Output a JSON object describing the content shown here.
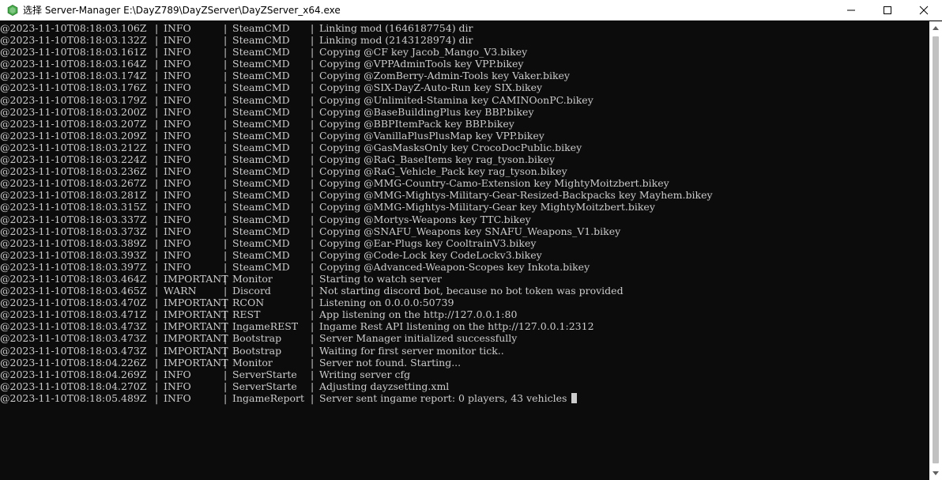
{
  "window": {
    "title": "选择 Server-Manager E:\\DayZ789\\DayZServer\\DayZServer_x64.exe",
    "app_icon": "green-hexagon-icon",
    "controls": {
      "minimize": "minimize-icon",
      "maximize": "maximize-icon",
      "close": "close-icon"
    }
  },
  "console": {
    "separator": "|",
    "lines": [
      {
        "ts": "@2023-11-10T08:18:03.106Z",
        "level": "INFO",
        "source": "SteamCMD",
        "message": "Linking mod (1646187754) dir"
      },
      {
        "ts": "@2023-11-10T08:18:03.132Z",
        "level": "INFO",
        "source": "SteamCMD",
        "message": "Linking mod (2143128974) dir"
      },
      {
        "ts": "@2023-11-10T08:18:03.161Z",
        "level": "INFO",
        "source": "SteamCMD",
        "message": "Copying @CF key Jacob_Mango_V3.bikey"
      },
      {
        "ts": "@2023-11-10T08:18:03.164Z",
        "level": "INFO",
        "source": "SteamCMD",
        "message": "Copying @VPPAdminTools key VPP.bikey"
      },
      {
        "ts": "@2023-11-10T08:18:03.174Z",
        "level": "INFO",
        "source": "SteamCMD",
        "message": "Copying @ZomBerry-Admin-Tools key Vaker.bikey"
      },
      {
        "ts": "@2023-11-10T08:18:03.176Z",
        "level": "INFO",
        "source": "SteamCMD",
        "message": "Copying @SIX-DayZ-Auto-Run key SIX.bikey"
      },
      {
        "ts": "@2023-11-10T08:18:03.179Z",
        "level": "INFO",
        "source": "SteamCMD",
        "message": "Copying @Unlimited-Stamina key CAMINOonPC.bikey"
      },
      {
        "ts": "@2023-11-10T08:18:03.200Z",
        "level": "INFO",
        "source": "SteamCMD",
        "message": "Copying @BaseBuildingPlus key BBP.bikey"
      },
      {
        "ts": "@2023-11-10T08:18:03.207Z",
        "level": "INFO",
        "source": "SteamCMD",
        "message": "Copying @BBPItemPack key BBP.bikey"
      },
      {
        "ts": "@2023-11-10T08:18:03.209Z",
        "level": "INFO",
        "source": "SteamCMD",
        "message": "Copying @VanillaPlusPlusMap key VPP.bikey"
      },
      {
        "ts": "@2023-11-10T08:18:03.212Z",
        "level": "INFO",
        "source": "SteamCMD",
        "message": "Copying @GasMasksOnly key CrocoDocPublic.bikey"
      },
      {
        "ts": "@2023-11-10T08:18:03.224Z",
        "level": "INFO",
        "source": "SteamCMD",
        "message": "Copying @RaG_BaseItems key rag_tyson.bikey"
      },
      {
        "ts": "@2023-11-10T08:18:03.236Z",
        "level": "INFO",
        "source": "SteamCMD",
        "message": "Copying @RaG_Vehicle_Pack key rag_tyson.bikey"
      },
      {
        "ts": "@2023-11-10T08:18:03.267Z",
        "level": "INFO",
        "source": "SteamCMD",
        "message": "Copying @MMG-Country-Camo-Extension key MightyMoitzbert.bikey"
      },
      {
        "ts": "@2023-11-10T08:18:03.281Z",
        "level": "INFO",
        "source": "SteamCMD",
        "message": "Copying @MMG-Mightys-Military-Gear-Resized-Backpacks key Mayhem.bikey"
      },
      {
        "ts": "@2023-11-10T08:18:03.315Z",
        "level": "INFO",
        "source": "SteamCMD",
        "message": "Copying @MMG-Mightys-Military-Gear key MightyMoitzbert.bikey"
      },
      {
        "ts": "@2023-11-10T08:18:03.337Z",
        "level": "INFO",
        "source": "SteamCMD",
        "message": "Copying @Mortys-Weapons key TTC.bikey"
      },
      {
        "ts": "@2023-11-10T08:18:03.373Z",
        "level": "INFO",
        "source": "SteamCMD",
        "message": "Copying @SNAFU_Weapons key SNAFU_Weapons_V1.bikey"
      },
      {
        "ts": "@2023-11-10T08:18:03.389Z",
        "level": "INFO",
        "source": "SteamCMD",
        "message": "Copying @Ear-Plugs key CooltrainV3.bikey"
      },
      {
        "ts": "@2023-11-10T08:18:03.393Z",
        "level": "INFO",
        "source": "SteamCMD",
        "message": "Copying @Code-Lock key CodeLockv3.bikey"
      },
      {
        "ts": "@2023-11-10T08:18:03.397Z",
        "level": "INFO",
        "source": "SteamCMD",
        "message": "Copying @Advanced-Weapon-Scopes key Inkota.bikey"
      },
      {
        "ts": "@2023-11-10T08:18:03.464Z",
        "level": "IMPORTANT",
        "source": "Monitor",
        "message": "Starting to watch server"
      },
      {
        "ts": "@2023-11-10T08:18:03.465Z",
        "level": "WARN",
        "source": "Discord",
        "message": "Not starting discord bot, because no bot token was provided"
      },
      {
        "ts": "@2023-11-10T08:18:03.470Z",
        "level": "IMPORTANT",
        "source": "RCON",
        "message": "Listening on 0.0.0.0:50739"
      },
      {
        "ts": "@2023-11-10T08:18:03.471Z",
        "level": "IMPORTANT",
        "source": "REST",
        "message": "App listening on the http://127.0.0.1:80"
      },
      {
        "ts": "@2023-11-10T08:18:03.473Z",
        "level": "IMPORTANT",
        "source": "IngameREST",
        "message": "Ingame Rest API listening on the http://127.0.0.1:2312"
      },
      {
        "ts": "@2023-11-10T08:18:03.473Z",
        "level": "IMPORTANT",
        "source": "Bootstrap",
        "message": "Server Manager initialized successfully"
      },
      {
        "ts": "@2023-11-10T08:18:03.473Z",
        "level": "IMPORTANT",
        "source": "Bootstrap",
        "message": "Waiting for first server monitor tick.."
      },
      {
        "ts": "@2023-11-10T08:18:04.226Z",
        "level": "IMPORTANT",
        "source": "Monitor",
        "message": "Server not found. Starting..."
      },
      {
        "ts": "@2023-11-10T08:18:04.269Z",
        "level": "INFO",
        "source": "ServerStarte",
        "message": "Writing server cfg"
      },
      {
        "ts": "@2023-11-10T08:18:04.270Z",
        "level": "INFO",
        "source": "ServerStarte",
        "message": "Adjusting dayzsetting.xml"
      },
      {
        "ts": "@2023-11-10T08:18:05.489Z",
        "level": "INFO",
        "source": "IngameReport",
        "message": "Server sent ingame report: 0 players, 43 vehicles"
      }
    ]
  }
}
